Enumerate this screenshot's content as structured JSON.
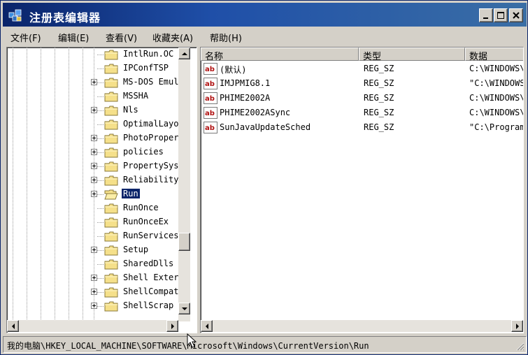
{
  "window": {
    "title": "注册表编辑器"
  },
  "menu": [
    {
      "label": "文件(F)"
    },
    {
      "label": "编辑(E)"
    },
    {
      "label": "查看(V)"
    },
    {
      "label": "收藏夹(A)"
    },
    {
      "label": "帮助(H)"
    }
  ],
  "tree": {
    "items": [
      {
        "label": "IntlRun.OC",
        "expandable": false,
        "selected": false
      },
      {
        "label": "IPConfTSP",
        "expandable": false,
        "selected": false
      },
      {
        "label": "MS-DOS Emul",
        "expandable": true,
        "selected": false
      },
      {
        "label": "MSSHA",
        "expandable": false,
        "selected": false
      },
      {
        "label": "Nls",
        "expandable": true,
        "selected": false
      },
      {
        "label": "OptimalLayo",
        "expandable": false,
        "selected": false
      },
      {
        "label": "PhotoProper",
        "expandable": true,
        "selected": false
      },
      {
        "label": "policies",
        "expandable": true,
        "selected": false
      },
      {
        "label": "PropertySys",
        "expandable": true,
        "selected": false
      },
      {
        "label": "Reliability",
        "expandable": true,
        "selected": false
      },
      {
        "label": "Run",
        "expandable": true,
        "selected": true
      },
      {
        "label": "RunOnce",
        "expandable": false,
        "selected": false
      },
      {
        "label": "RunOnceEx",
        "expandable": false,
        "selected": false
      },
      {
        "label": "RunServices",
        "expandable": false,
        "selected": false
      },
      {
        "label": "Setup",
        "expandable": true,
        "selected": false
      },
      {
        "label": "SharedDlls",
        "expandable": false,
        "selected": false
      },
      {
        "label": "Shell Exter",
        "expandable": true,
        "selected": false
      },
      {
        "label": "ShellCompat",
        "expandable": true,
        "selected": false
      },
      {
        "label": "ShellScrap",
        "expandable": true,
        "selected": false
      }
    ]
  },
  "list": {
    "columns": [
      {
        "label": "名称"
      },
      {
        "label": "类型"
      },
      {
        "label": "数据"
      }
    ],
    "rows": [
      {
        "name": "(默认)",
        "type": "REG_SZ",
        "data": "C:\\WINDOWS\\"
      },
      {
        "name": "IMJPMIG8.1",
        "type": "REG_SZ",
        "data": "\"C:\\WINDOWS"
      },
      {
        "name": "PHIME2002A",
        "type": "REG_SZ",
        "data": "C:\\WINDOWS\\"
      },
      {
        "name": "PHIME2002ASync",
        "type": "REG_SZ",
        "data": "C:\\WINDOWS\\"
      },
      {
        "name": "SunJavaUpdateSched",
        "type": "REG_SZ",
        "data": "\"C:\\Program"
      }
    ]
  },
  "status": {
    "path": "我的电脑\\HKEY_LOCAL_MACHINE\\SOFTWARE\\Microsoft\\Windows\\CurrentVersion\\Run"
  },
  "icons": {
    "app": "registry-editor-icon",
    "minimize": "minimize-icon",
    "maximize": "maximize-icon",
    "close": "close-icon",
    "folder": "folder-icon",
    "open_folder": "open-folder-icon",
    "string_value": "string-value-icon",
    "resize_grip": "resize-grip-icon",
    "cursor": "mouse-cursor-icon"
  },
  "colors": {
    "title_start": "#0a246a",
    "title_end": "#3a6ea5",
    "chrome": "#d4d0c8",
    "selection": "#0a246a",
    "string_icon": "#b01010"
  }
}
